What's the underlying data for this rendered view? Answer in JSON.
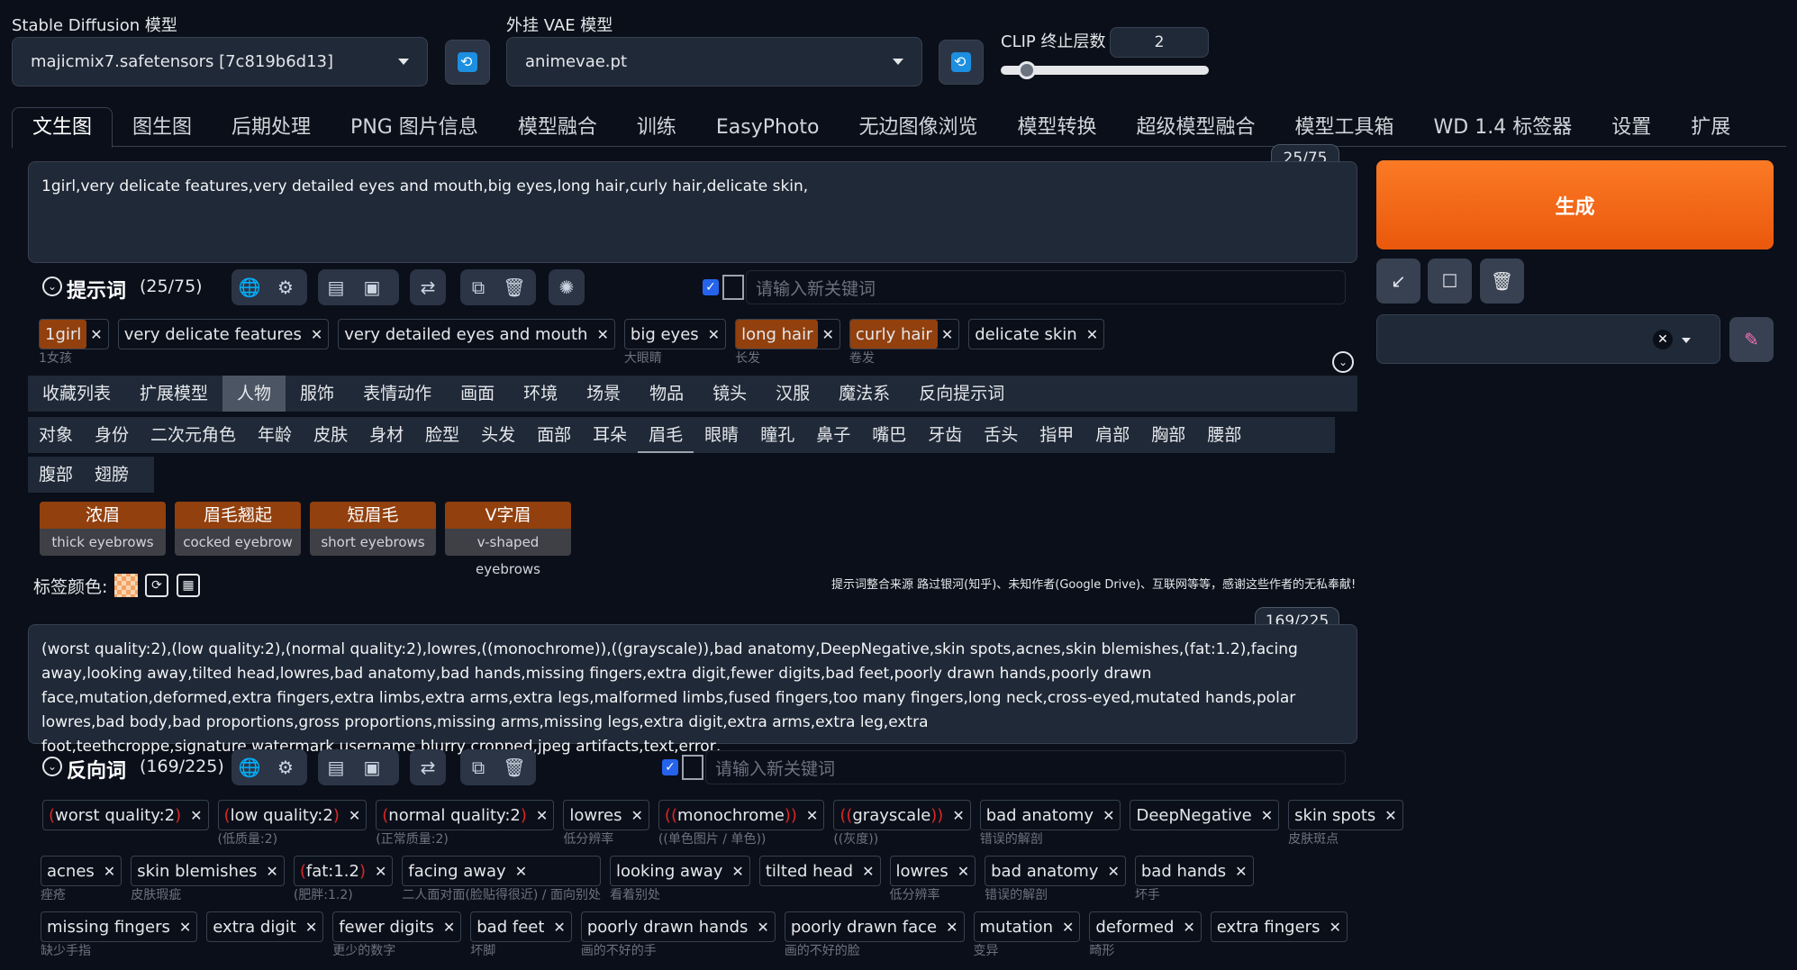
{
  "header": {
    "sd_model_label": "Stable Diffusion 模型",
    "sd_model_value": "majicmix7.safetensors [7c819b6d13]",
    "vae_label": "外挂 VAE 模型",
    "vae_value": "animevae.pt",
    "clip_label": "CLIP 终止层数",
    "clip_value": "2",
    "clip_slider_fraction": 0.12
  },
  "tabs": [
    "文生图",
    "图生图",
    "后期处理",
    "PNG 图片信息",
    "模型融合",
    "训练",
    "EasyPhoto",
    "无边图像浏览",
    "模型转换",
    "超级模型融合",
    "模型工具箱",
    "WD 1.4 标签器",
    "设置",
    "扩展"
  ],
  "prompt": {
    "text": "1girl,very delicate features,very detailed eyes and mouth,big eyes,long hair,curly hair,delicate skin,",
    "counter": "25/75",
    "section_title": "提示词",
    "section_count": "(25/75)",
    "keyword_placeholder": "请输入新关键词",
    "tags": [
      {
        "text": "1girl",
        "sub": "1女孩",
        "hl": true
      },
      {
        "text": "very delicate features",
        "sub": "",
        "hl": false
      },
      {
        "text": "very detailed eyes and mouth",
        "sub": "",
        "hl": false
      },
      {
        "text": "big eyes",
        "sub": "大眼睛",
        "hl": false
      },
      {
        "text": "long hair",
        "sub": "长发",
        "hl": true
      },
      {
        "text": "curly hair",
        "sub": "卷发",
        "hl": true
      },
      {
        "text": "delicate skin",
        "sub": "",
        "hl": false
      }
    ]
  },
  "categories": [
    "收藏列表",
    "扩展模型",
    "人物",
    "服饰",
    "表情动作",
    "画面",
    "环境",
    "场景",
    "物品",
    "镜头",
    "汉服",
    "魔法系",
    "反向提示词"
  ],
  "subcategories_row1": [
    "对象",
    "身份",
    "二次元角色",
    "年龄",
    "皮肤",
    "身材",
    "脸型",
    "头发",
    "面部",
    "耳朵",
    "眉毛",
    "眼睛",
    "瞳孔",
    "鼻子",
    "嘴巴",
    "牙齿",
    "舌头",
    "指甲",
    "肩部",
    "胸部",
    "腰部"
  ],
  "subcategories_row2": [
    "腹部",
    "翅膀"
  ],
  "candidates": [
    {
      "main": "浓眉",
      "sub": "thick eyebrows"
    },
    {
      "main": "眉毛翘起",
      "sub": "cocked eyebrow"
    },
    {
      "main": "短眉毛",
      "sub": "short eyebrows"
    },
    {
      "main": "V字眉",
      "sub": "v-shaped eyebrows"
    }
  ],
  "tag_color_label": "标签颜色:",
  "credit": "提示词整合来源 路过银河(知乎)、未知作者(Google Drive)、互联网等等，感谢这些作者的无私奉献!",
  "negative": {
    "text": "(worst quality:2),(low quality:2),(normal quality:2),lowres,((monochrome)),((grayscale)),bad anatomy,DeepNegative,skin spots,acnes,skin blemishes,(fat:1.2),facing away,looking away,tilted head,lowres,bad anatomy,bad hands,missing fingers,extra digit,fewer digits,bad feet,poorly drawn hands,poorly drawn face,mutation,deformed,extra fingers,extra limbs,extra arms,extra legs,malformed limbs,fused fingers,too many fingers,long neck,cross-eyed,mutated hands,polar lowres,bad body,bad proportions,gross proportions,missing arms,missing legs,extra digit,extra arms,extra leg,extra foot,teethcroppe,signature,watermark,username,blurry,cropped,jpeg artifacts,text,error,",
    "counter": "169/225",
    "section_title": "反向词",
    "section_count": "(169/225)",
    "keyword_placeholder": "请输入新关键词",
    "row1": [
      {
        "pre": "(",
        "text": "worst quality:2",
        "post": ")",
        "sub": ""
      },
      {
        "pre": "(",
        "text": "low quality:2",
        "post": ")",
        "sub": "(低质量:2)"
      },
      {
        "pre": "(",
        "text": "normal quality:2",
        "post": ")",
        "sub": "(正常质量:2)"
      },
      {
        "pre": "",
        "text": "lowres",
        "post": "",
        "sub": "低分辨率"
      },
      {
        "pre": "((",
        "text": "monochrome",
        "post": "))",
        "sub": "((单色图片 / 单色))"
      },
      {
        "pre": "((",
        "text": "grayscale",
        "post": "))",
        "sub": "((灰度))"
      },
      {
        "pre": "",
        "text": "bad anatomy",
        "post": "",
        "sub": "错误的解剖"
      },
      {
        "pre": "",
        "text": "DeepNegative",
        "post": "",
        "sub": ""
      },
      {
        "pre": "",
        "text": "skin spots",
        "post": "",
        "sub": "皮肤斑点"
      }
    ],
    "row2": [
      {
        "pre": "",
        "text": "acnes",
        "post": "",
        "sub": "痤疮"
      },
      {
        "pre": "",
        "text": "skin blemishes",
        "post": "",
        "sub": "皮肤瑕疵"
      },
      {
        "pre": "(",
        "text": "fat:1.2",
        "post": ")",
        "sub": "(肥胖:1.2)"
      },
      {
        "pre": "",
        "text": "facing away",
        "post": "",
        "sub": "二人面对面(脸贴得很近) / 面向别处"
      },
      {
        "pre": "",
        "text": "looking away",
        "post": "",
        "sub": "看着别处"
      },
      {
        "pre": "",
        "text": "tilted head",
        "post": "",
        "sub": ""
      },
      {
        "pre": "",
        "text": "lowres",
        "post": "",
        "sub": "低分辨率"
      },
      {
        "pre": "",
        "text": "bad anatomy",
        "post": "",
        "sub": "错误的解剖"
      },
      {
        "pre": "",
        "text": "bad hands",
        "post": "",
        "sub": "坏手"
      }
    ],
    "row3": [
      {
        "pre": "",
        "text": "missing fingers",
        "post": "",
        "sub": "缺少手指"
      },
      {
        "pre": "",
        "text": "extra digit",
        "post": "",
        "sub": ""
      },
      {
        "pre": "",
        "text": "fewer digits",
        "post": "",
        "sub": "更少的数字"
      },
      {
        "pre": "",
        "text": "bad feet",
        "post": "",
        "sub": "坏脚"
      },
      {
        "pre": "",
        "text": "poorly drawn hands",
        "post": "",
        "sub": "画的不好的手"
      },
      {
        "pre": "",
        "text": "poorly drawn face",
        "post": "",
        "sub": "画的不好的脸"
      },
      {
        "pre": "",
        "text": "mutation",
        "post": "",
        "sub": "变异"
      },
      {
        "pre": "",
        "text": "deformed",
        "post": "",
        "sub": "畸形"
      },
      {
        "pre": "",
        "text": "extra fingers",
        "post": "",
        "sub": ""
      }
    ]
  },
  "right": {
    "generate_label": "生成"
  },
  "colors": {
    "accent_orange": "#f97316",
    "highlight_tag": "#92400e",
    "background": "#0b0f19"
  }
}
